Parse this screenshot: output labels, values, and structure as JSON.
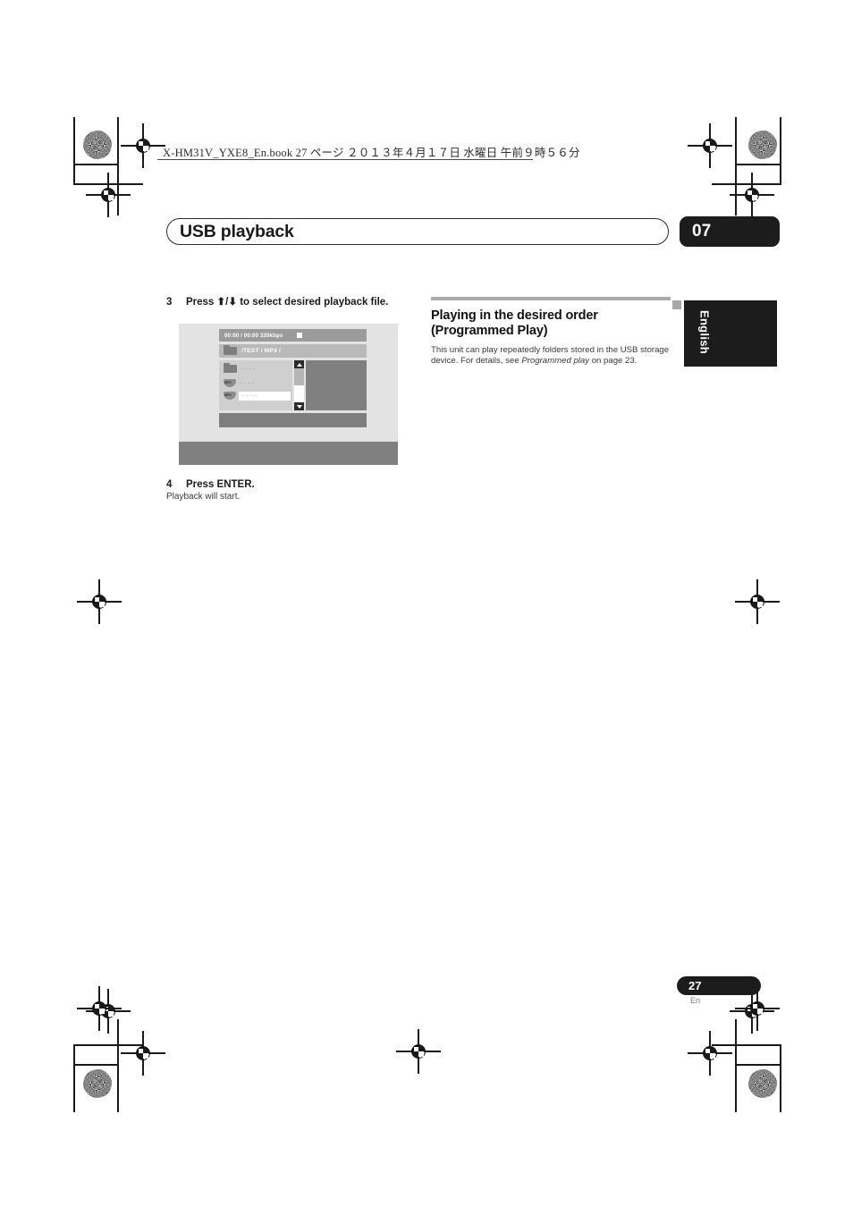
{
  "print_header": {
    "note": "X-HM31V_YXE8_En.book   27 ページ   ２０１３年４月１７日   水曜日   午前９時５６分"
  },
  "page_title": {
    "title": "USB playback",
    "chapter": "07"
  },
  "left_column": {
    "step3": {
      "number": "3",
      "text": "Press ⬆/⬇ to select desired playback file."
    },
    "step4": {
      "number": "4",
      "text": "Press ENTER.",
      "sub": "Playback will start."
    },
    "screen_mock": {
      "status_text": "00:00 / 00:00   320kbps",
      "status_icon": "stop-icon",
      "path_text": "/TEST /  MP3 /",
      "path_icon": "folder-icon",
      "rows": [
        {
          "icon": "folder-icon",
          "label": "- - - -",
          "selected": false
        },
        {
          "icon": "mp3-icon",
          "label": "- - - -",
          "selected": false
        },
        {
          "icon": "mp3-icon",
          "label": "- - - -",
          "selected": true
        }
      ],
      "scrollbar": {
        "up_icon": "scroll-up-icon",
        "down_icon": "scroll-down-icon"
      },
      "mp3_icon_label": "MP3"
    }
  },
  "right_column": {
    "heading_line1": "Playing in the desired order",
    "heading_line2": "(Programmed Play)",
    "body_before_italic": "This unit can play repeatedly folders stored in the USB storage device. For details, see ",
    "body_italic": "Programmed play",
    "body_after_italic": " on page 23."
  },
  "language_tab": {
    "label": "English"
  },
  "footer": {
    "page_number": "27",
    "language_code": "En"
  },
  "colors": {
    "ink": "#1c1c1c",
    "screen_status_bar": "#9b9b9b",
    "screen_path_bar": "#b9b9b9",
    "screen_list_bg": "#cfcfcf",
    "screen_preview": "#808080"
  }
}
